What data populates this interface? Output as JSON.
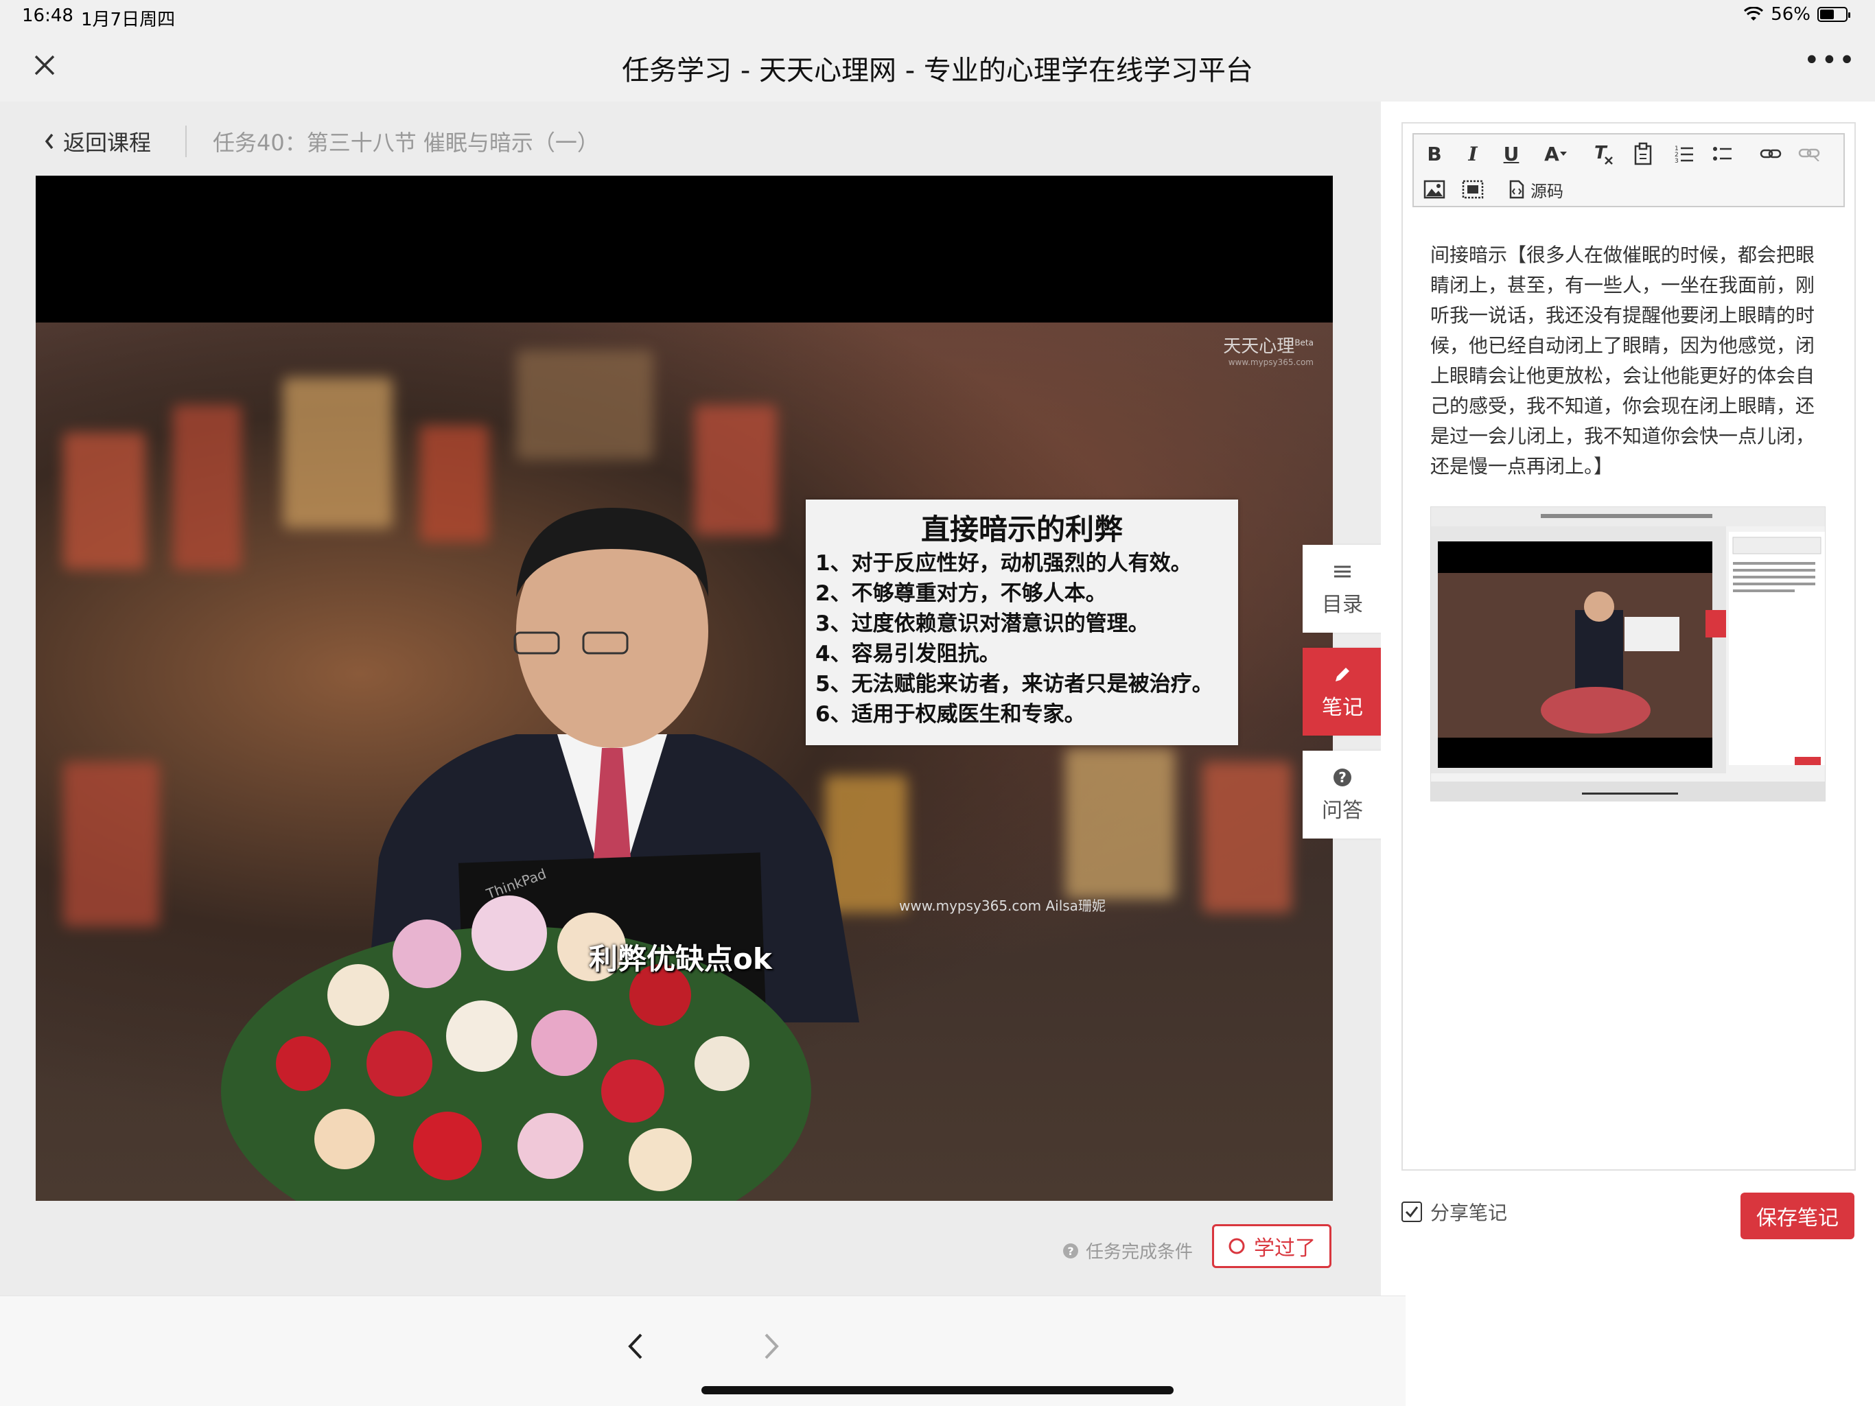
{
  "status_bar": {
    "time": "16:48",
    "date": "1月7日周四",
    "battery": "56%",
    "battery_level": 0.56
  },
  "header": {
    "title": "任务学习 - 天天心理网 - 专业的心理学在线学习平台",
    "more": "•••"
  },
  "breadcrumb": {
    "back_label": "返回课程",
    "task_title": "任务40：第三十八节 催眠与暗示（一）"
  },
  "video": {
    "logo_text": "天天心理",
    "logo_beta": "Beta",
    "logo_url": "www.mypsy365.com",
    "watermark": "www.mypsy365.com Ailsa珊妮",
    "subtitle": "利弊优缺点ok",
    "laptop_brand": "ThinkPad",
    "slide": {
      "title": "直接暗示的利弊",
      "lines": [
        "1、对于反应性好，动机强烈的人有效。",
        "2、不够尊重对方，不够人本。",
        "3、过度依赖意识对潜意识的管理。",
        "4、容易引发阻抗。",
        "5、无法赋能来访者，来访者只是被治疗。",
        "6、适用于权威医生和专家。"
      ]
    }
  },
  "side_tabs": {
    "catalog": "目录",
    "notes": "笔记",
    "qa": "问答"
  },
  "footer": {
    "completion_condition": "任务完成条件",
    "learned_button": "学过了"
  },
  "editor": {
    "toolbar": {
      "bold": "B",
      "italic": "I",
      "underline": "U",
      "font_color": "A",
      "source_label": "源码"
    },
    "content": "间接暗示【很多人在做催眠的时候，都会把眼睛闭上，甚至，有一些人，一坐在我面前，刚听我一说话，我还没有提醒他要闭上眼睛的时候，他已经自动闭上了眼睛，因为他感觉，闭上眼睛会让他更放松，会让他能更好的体会自己的感受，我不知道，你会现在闭上眼睛，还是过一会儿闭上，我不知道你会快一点儿闭，还是慢一点再闭上。】",
    "share_label": "分享笔记",
    "share_checked": true,
    "save_button": "保存笔记"
  },
  "colors": {
    "accent": "#d9363e",
    "panel_bg": "#ececec",
    "header_bg": "#f0f0f0"
  }
}
